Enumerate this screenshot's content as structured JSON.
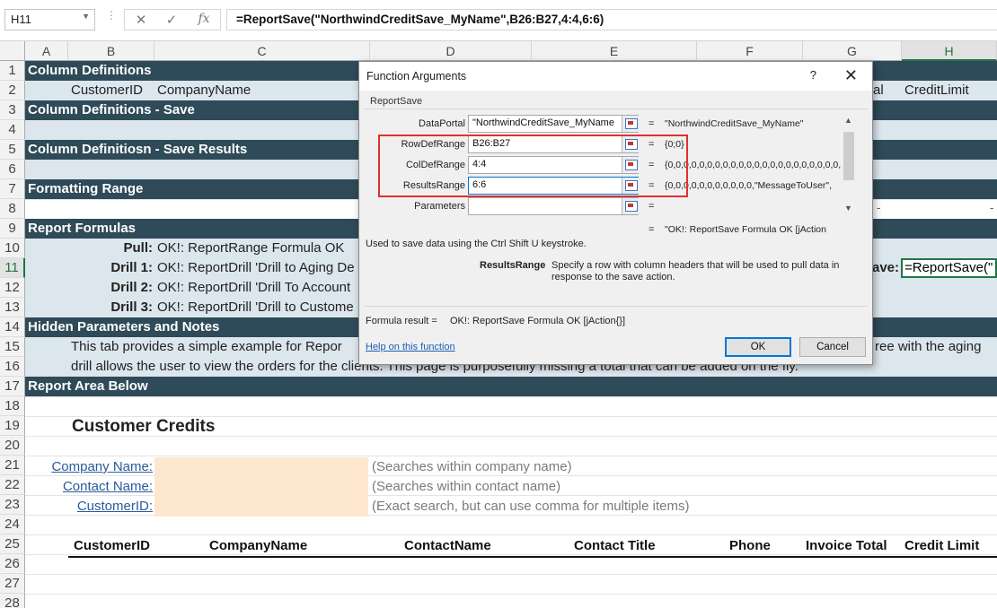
{
  "formula_bar": {
    "name_box": "H11",
    "formula": "=ReportSave(\"NorthwindCreditSave_MyName\",B26:B27,4:4,6:6)",
    "fx": "fx"
  },
  "columns": [
    "A",
    "B",
    "C",
    "D",
    "E",
    "F",
    "G",
    "H"
  ],
  "rows": [
    "1",
    "2",
    "3",
    "4",
    "5",
    "6",
    "7",
    "8",
    "9",
    "10",
    "11",
    "12",
    "13",
    "14",
    "15",
    "16",
    "17",
    "18",
    "19",
    "20",
    "21",
    "22",
    "23",
    "24",
    "25",
    "26",
    "27",
    "28"
  ],
  "sheet": {
    "r1": "Column Definitions",
    "r2": {
      "b": "CustomerID",
      "c": "CompanyName",
      "g_tail": "al",
      "h": "CreditLimit"
    },
    "r3": "Column Definitions - Save",
    "r5": "Column Definitiosn - Save Results",
    "r7": "Formatting Range",
    "r8_dash1": "-",
    "r8_dash2": "-",
    "r9": "Report Formulas",
    "r10": {
      "label": "Pull:",
      "text": "OK!: ReportRange Formula OK"
    },
    "r11": {
      "label": "Drill 1:",
      "text": "OK!: ReportDrill 'Drill to Aging De",
      "g_tail": "ave:",
      "h": "=ReportSave(\""
    },
    "r12": {
      "label": "Drill 2:",
      "text": "OK!: ReportDrill 'Drill To Account"
    },
    "r13": {
      "label": "Drill 3:",
      "text": "OK!: ReportDrill 'Drill to Custome"
    },
    "r14": "Hidden Parameters and Notes",
    "r15": {
      "left": "This tab provides a simple example for Repor",
      "right": "ree with the aging"
    },
    "r16": "drill allows the user to view the orders for the clients.   This page is purposefully missing a total that can be added on the fly.",
    "r17": "Report Area Below",
    "report_title": "Customer Credits",
    "filters": [
      {
        "label": "Company Name:",
        "hint": "(Searches within company name)"
      },
      {
        "label": "Contact Name:",
        "hint": "(Searches within contact name)"
      },
      {
        "label": "CustomerID:",
        "hint": "(Exact search, but can use comma for multiple items)"
      }
    ],
    "report_headers": [
      "CustomerID",
      "CompanyName",
      "ContactName",
      "Contact Title",
      "Phone",
      "Invoice Total",
      "Credit Limit"
    ]
  },
  "dialog": {
    "title": "Function Arguments",
    "help_glyph": "?",
    "close_glyph": "✕",
    "function_name": "ReportSave",
    "args": [
      {
        "label": "DataPortal",
        "value": "\"NorthwindCreditSave_MyName",
        "result": "\"NorthwindCreditSave_MyName\""
      },
      {
        "label": "RowDefRange",
        "value": "B26:B27",
        "result": "{0;0}"
      },
      {
        "label": "ColDefRange",
        "value": "4:4",
        "result": "{0,0,0,0,0,0,0,0,0,0,0,0,0,0,0,0,0,0,0,0,0,0,"
      },
      {
        "label": "ResultsRange",
        "value": "6:6",
        "result": "{0,0,0,0,0,0,0,0,0,0,0,\"MessageToUser\","
      },
      {
        "label": "Parameters",
        "value": "",
        "result": ""
      }
    ],
    "eq": "=",
    "overall_result": "\"OK!: ReportSave Formula OK [jAction",
    "description": "Used to save data using the Ctrl Shift U keystroke.",
    "arg_help_name": "ResultsRange",
    "arg_help_text_1": "Specify a row with column headers that will be used to pull data in",
    "arg_help_text_2": "response to the save action.",
    "formula_result_label": "Formula result =",
    "formula_result_value": "OK!: ReportSave Formula OK [jAction{}]",
    "help_link": "Help on this function",
    "ok": "OK",
    "cancel": "Cancel"
  }
}
